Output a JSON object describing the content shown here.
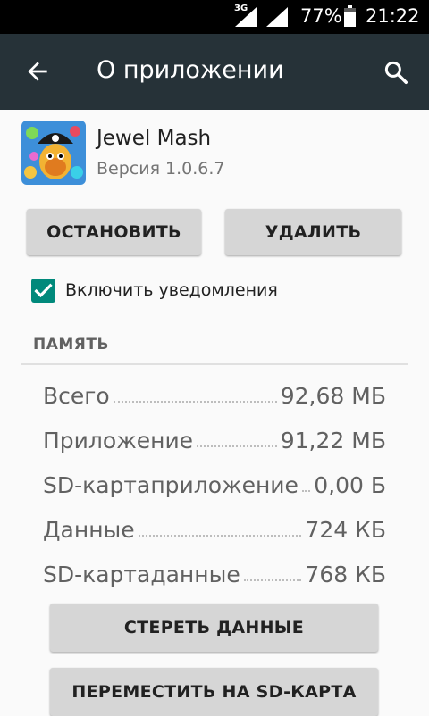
{
  "status_bar": {
    "network": "3G",
    "battery_percent": "77%",
    "time": "21:22"
  },
  "app_bar": {
    "title": "О приложении",
    "icons": {
      "back": "arrow-left-icon",
      "search": "search-icon"
    }
  },
  "app": {
    "name": "Jewel Mash",
    "version": "Версия 1.0.6.7"
  },
  "actions": {
    "stop_label": "ОСТАНОВИТЬ",
    "delete_label": "УДАЛИТЬ"
  },
  "notifications": {
    "label": "Включить уведомления",
    "checked": true
  },
  "storage": {
    "header": "ПАМЯТЬ",
    "rows": [
      {
        "label": "Всего",
        "value": "92,68 МБ"
      },
      {
        "label": "Приложение",
        "value": "91,22 МБ"
      },
      {
        "label": "SD-картаприложение",
        "value": "0,00 Б"
      },
      {
        "label": "Данные",
        "value": "724 КБ"
      },
      {
        "label": "SD-картаданные",
        "value": "768 КБ"
      }
    ],
    "clear_label": "СТЕРЕТЬ ДАННЫЕ",
    "move_label": "ПЕРЕМЕСТИТЬ НА SD-КАРТА"
  },
  "colors": {
    "app_bar": "#263238",
    "status_bar": "#000000",
    "accent": "#00897b",
    "button": "#d6d6d6"
  }
}
